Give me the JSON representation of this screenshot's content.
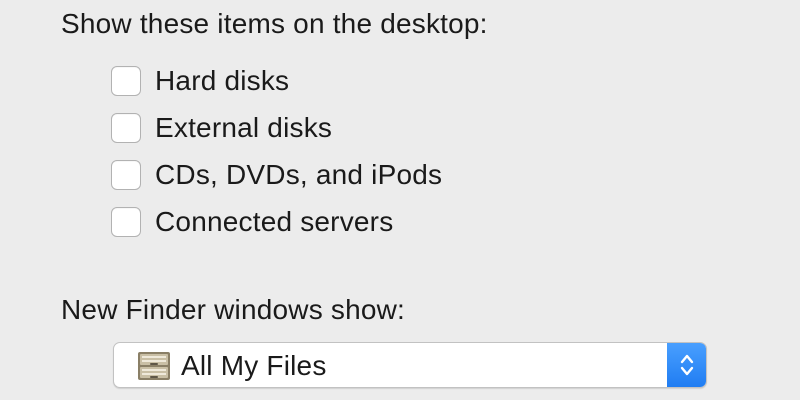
{
  "desktop_section": {
    "title": "Show these items on the desktop:",
    "items": [
      {
        "label": "Hard disks",
        "checked": false
      },
      {
        "label": "External disks",
        "checked": false
      },
      {
        "label": "CDs, DVDs, and iPods",
        "checked": false
      },
      {
        "label": "Connected servers",
        "checked": false
      }
    ]
  },
  "finder_section": {
    "title": "New Finder windows show:",
    "popup": {
      "value": "All My Files",
      "icon": "all-my-files-drawer-icon",
      "stepper_icon": "up-down-chevron-icon"
    }
  },
  "colors": {
    "background": "#ececec",
    "accent": "#1f7cf2"
  }
}
